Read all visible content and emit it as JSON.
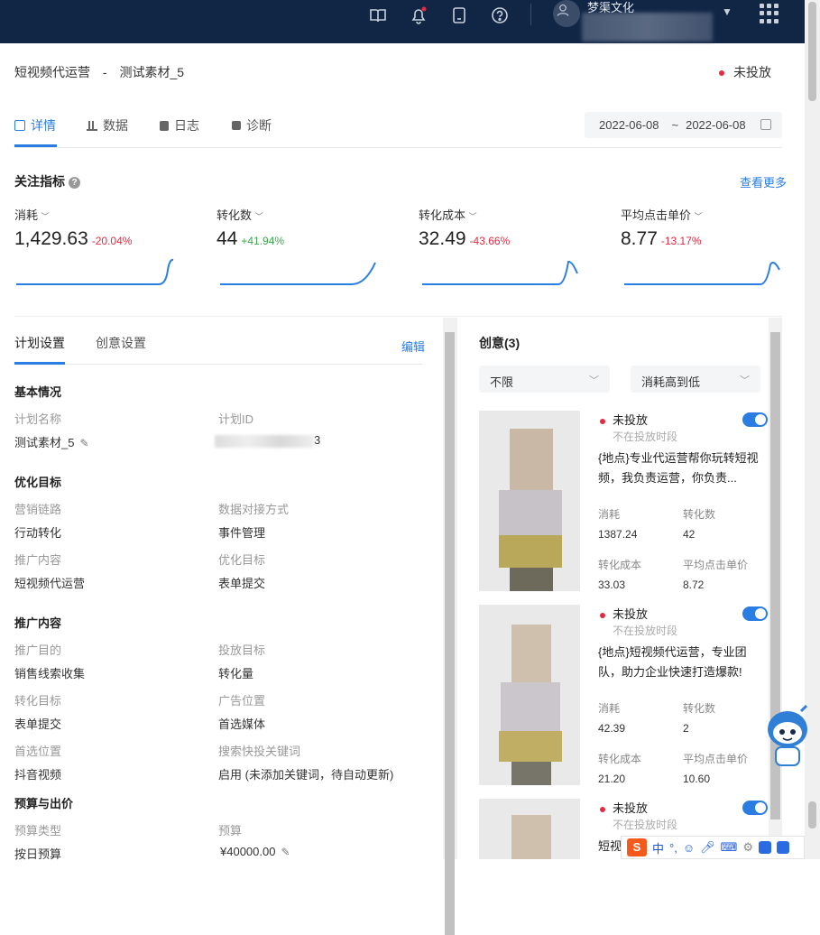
{
  "topbar": {
    "icons": [
      "book-icon",
      "bell-icon",
      "tablet-icon",
      "help-icon",
      "user-icon",
      "apps-grid-icon"
    ],
    "account_name": "梦渠文化"
  },
  "breadcrumb": {
    "part1": "短视频代运营",
    "sep": "-",
    "part2": "测试素材_5"
  },
  "status": "未投放",
  "tabs": [
    {
      "label": "详情",
      "icon": "chart-icon"
    },
    {
      "label": "数据",
      "icon": "bar-chart-icon"
    },
    {
      "label": "日志",
      "icon": "log-icon"
    },
    {
      "label": "诊断",
      "icon": "diagnose-icon"
    }
  ],
  "date_range": {
    "start": "2022-06-08",
    "sep": "~",
    "end": "2022-06-08"
  },
  "metrics_section": {
    "title": "关注指标",
    "help": "?",
    "more": "查看更多"
  },
  "metrics": [
    {
      "label": "消耗",
      "value": "1,429.63",
      "change": "-20.04%",
      "trend": "down"
    },
    {
      "label": "转化数",
      "value": "44",
      "change": "+41.94%",
      "trend": "up"
    },
    {
      "label": "转化成本",
      "value": "32.49",
      "change": "-43.66%",
      "trend": "down"
    },
    {
      "label": "平均点击单价",
      "value": "8.77",
      "change": "-13.17%",
      "trend": "down"
    }
  ],
  "plan_tabs": {
    "plan": "计划设置",
    "creative": "创意设置",
    "edit": "编辑"
  },
  "basic": {
    "title": "基本情况",
    "plan_name_label": "计划名称",
    "plan_name": "测试素材_5",
    "plan_id_label": "计划ID",
    "plan_id_tail": "3"
  },
  "optimize": {
    "title": "优化目标",
    "chain_label": "营销链路",
    "chain": "行动转化",
    "data_label": "数据对接方式",
    "data": "事件管理",
    "promo_label": "推广内容",
    "promo": "短视频代运营",
    "target_label": "优化目标",
    "target": "表单提交"
  },
  "promotion": {
    "title": "推广内容",
    "purpose_label": "推广目的",
    "purpose": "销售线索收集",
    "delivery_label": "投放目标",
    "delivery": "转化量",
    "conv_label": "转化目标",
    "conv": "表单提交",
    "ad_pos_label": "广告位置",
    "ad_pos": "首选媒体",
    "pref_label": "首选位置",
    "pref": "抖音视频",
    "kw_label": "搜索快投关键词",
    "kw": "启用 (未添加关键词，待自动更新)"
  },
  "budget": {
    "title": "预算与出价",
    "type_label": "预算类型",
    "type": "按日预算",
    "amount_label": "预算",
    "amount": "¥40000.00"
  },
  "creatives": {
    "title": "创意(3)",
    "filter": "不限",
    "sort": "消耗高到低",
    "items": [
      {
        "status": "未投放",
        "sub": "不在投放时段",
        "desc": "{地点}专业代运营帮你玩转短视频，我负责运营，你负责...",
        "spend_label": "消耗",
        "spend": "1387.24",
        "conv_label": "转化数",
        "conv": "42",
        "cost_label": "转化成本",
        "cost": "33.03",
        "cpc_label": "平均点击单价",
        "cpc": "8.72"
      },
      {
        "status": "未投放",
        "sub": "不在投放时段",
        "desc": "{地点}短视频代运营，专业团队，助力企业快速打造爆款!",
        "spend_label": "消耗",
        "spend": "42.39",
        "conv_label": "转化数",
        "conv": "2",
        "cost_label": "转化成本",
        "cost": "21.20",
        "cpc_label": "平均点击单价",
        "cpc": "10.60"
      },
      {
        "status": "未投放",
        "sub": "不在投放时段",
        "desc": "短视"
      }
    ]
  },
  "ime": {
    "lang": "中",
    "punct": "°,"
  },
  "colors": {
    "accent": "#2a7de1",
    "topbar": "#112545",
    "negative": "#e5293f",
    "positive": "#3aa64a"
  }
}
